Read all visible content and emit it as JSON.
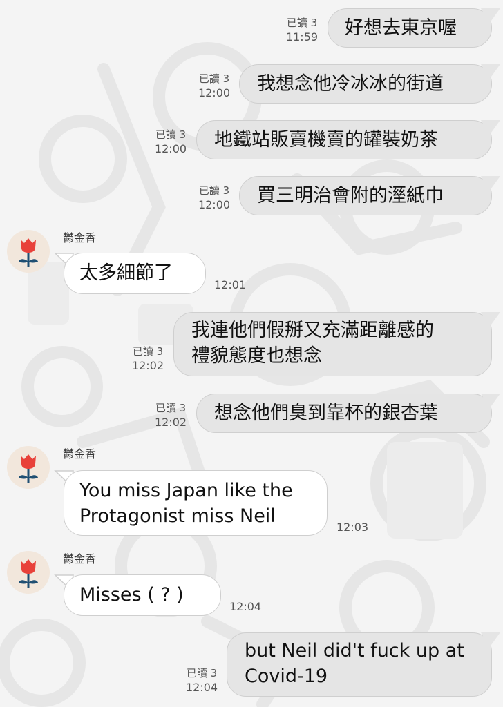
{
  "chat": {
    "read_label": "已讀 3",
    "contact_name": "鬱金香",
    "messages": [
      {
        "dir": "out",
        "lines": [
          "好想去東京喔"
        ],
        "time": "11:59"
      },
      {
        "dir": "out",
        "lines": [
          "我想念他冷冰冰的街道"
        ],
        "time": "12:00"
      },
      {
        "dir": "out",
        "lines": [
          "地鐵站販賣機賣的罐裝奶茶"
        ],
        "time": "12:00"
      },
      {
        "dir": "out",
        "lines": [
          "買三明治會附的溼紙巾"
        ],
        "time": "12:00"
      },
      {
        "dir": "in",
        "lines": [
          "太多細節了"
        ],
        "time": "12:01"
      },
      {
        "dir": "out",
        "lines": [
          "我連他們假掰又充滿距離感的",
          "禮貌態度也想念"
        ],
        "time": "12:02"
      },
      {
        "dir": "out",
        "lines": [
          "想念他們臭到靠杯的銀杏葉"
        ],
        "time": "12:02"
      },
      {
        "dir": "in",
        "lines": [
          "You miss Japan like the",
          "Protagonist miss Neil"
        ],
        "time": "12:03"
      },
      {
        "dir": "in",
        "lines": [
          "Misses ( ? )"
        ],
        "time": "12:04"
      },
      {
        "dir": "out",
        "lines": [
          "but Neil did't fuck up at",
          "Covid-19"
        ],
        "time": "12:04"
      }
    ]
  },
  "colors": {
    "background": "#f4f4f4",
    "outgoing_bubble": "#e5e5e5",
    "incoming_bubble": "#ffffff",
    "avatar_bg": "#f2e7dc",
    "tulip_red": "#e8413a",
    "tulip_stem": "#1f4f73"
  },
  "icons": {
    "avatar": "tulip-icon"
  }
}
